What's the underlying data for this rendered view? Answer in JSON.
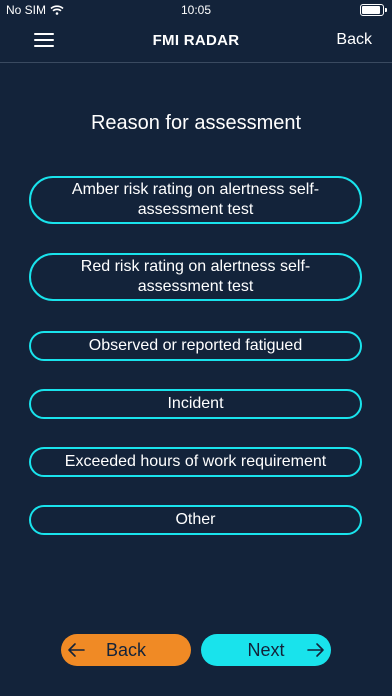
{
  "status": {
    "carrier": "No SIM",
    "time": "10:05"
  },
  "nav": {
    "title": "FMI RADAR",
    "back_label": "Back"
  },
  "heading": "Reason for assessment",
  "options": [
    {
      "label": "Amber risk rating on alertness self-assessment test"
    },
    {
      "label": "Red risk rating on alertness self-assessment test"
    },
    {
      "label": "Observed or reported fatigued"
    },
    {
      "label": "Incident"
    },
    {
      "label": "Exceeded hours of work requirement"
    },
    {
      "label": "Other"
    }
  ],
  "footer": {
    "back_label": "Back",
    "next_label": "Next"
  },
  "colors": {
    "background": "#13233a",
    "accent": "#19e3ec",
    "back_button": "#f08a25"
  },
  "icons": [
    "menu-icon",
    "wifi-icon",
    "battery-icon",
    "arrow-left-icon",
    "arrow-right-icon"
  ]
}
